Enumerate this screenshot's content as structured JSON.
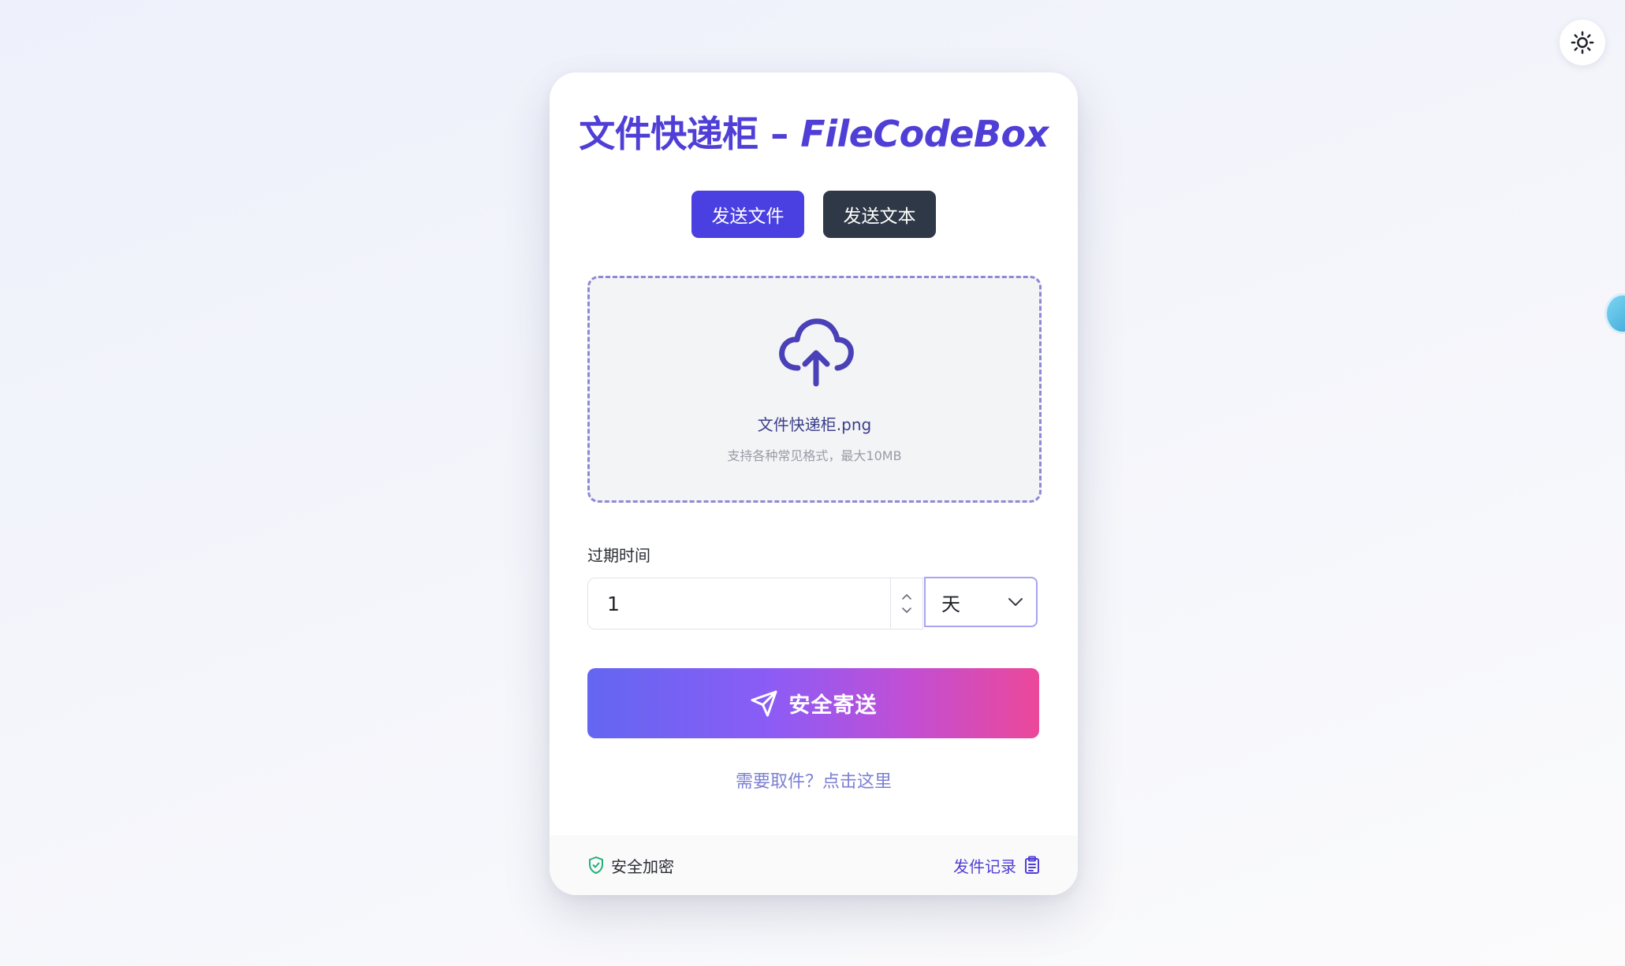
{
  "app": {
    "title_cn": "文件快递柜",
    "title_sep": "–",
    "title_en": "FileCodeBox"
  },
  "tabs": [
    {
      "label": "发送文件",
      "active": true
    },
    {
      "label": "发送文本",
      "active": false
    }
  ],
  "upload": {
    "file_name": "文件快递柜.png",
    "hint": "支持各种常见格式，最大10MB"
  },
  "expiration": {
    "label": "过期时间",
    "value": "1",
    "unit": "天"
  },
  "send_button": {
    "label": "安全寄送"
  },
  "retrieve_link": "需要取件？点击这里",
  "footer": {
    "secure_label": "安全加密",
    "history_label": "发件记录"
  },
  "colors": {
    "accent": "#4f3fd6",
    "tab_active": "#4a3fe0",
    "tab_inactive": "#2f3847",
    "gradient_start": "#6366f1",
    "gradient_end": "#ec4899",
    "secure_green": "#22b07a"
  },
  "icons": {
    "theme": "sun-icon",
    "upload": "cloud-upload-icon",
    "send": "paper-plane-icon",
    "secure": "shield-check-icon",
    "history": "clipboard-icon",
    "unit_dropdown": "chevron-down-icon"
  }
}
